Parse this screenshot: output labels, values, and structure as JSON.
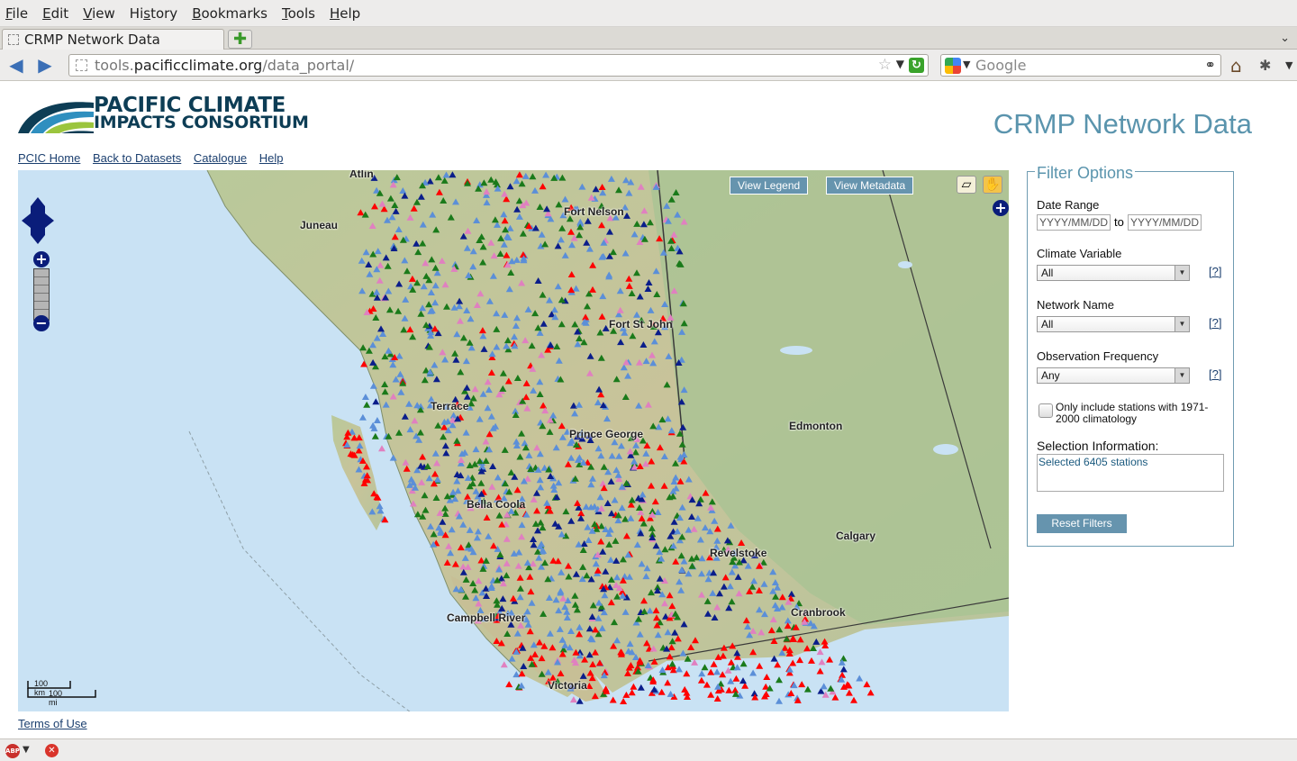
{
  "browser": {
    "menu": [
      {
        "label": "File",
        "key": "F",
        "rest": "ile"
      },
      {
        "label": "Edit",
        "key": "E",
        "rest": "dit"
      },
      {
        "label": "View",
        "key": "V",
        "rest": "iew"
      },
      {
        "label": "History",
        "pre": "Hi",
        "key": "s",
        "rest": "tory"
      },
      {
        "label": "Bookmarks",
        "key": "B",
        "rest": "ookmarks"
      },
      {
        "label": "Tools",
        "key": "T",
        "rest": "ools"
      },
      {
        "label": "Help",
        "key": "H",
        "rest": "elp"
      }
    ],
    "tab_title": "CRMP Network Data",
    "url_prefix": "tools.",
    "url_host": "pacificclimate.org",
    "url_path": "/data_portal/",
    "search_placeholder": "Google"
  },
  "header": {
    "logo_line1": "PACIFIC CLIMATE",
    "logo_line2": "IMPACTS CONSORTIUM",
    "title": "CRMP Network Data"
  },
  "nav_links": [
    "PCIC Home",
    "Back to Datasets",
    "Catalogue",
    "Help"
  ],
  "map": {
    "view_legend": "View Legend",
    "view_metadata": "View Metadata",
    "scale_km": "100 km",
    "scale_mi": "100 mi",
    "cities": [
      {
        "name": "Atlin"
      },
      {
        "name": "Juneau"
      },
      {
        "name": "Fort Nelson"
      },
      {
        "name": "Fort St John"
      },
      {
        "name": "Terrace"
      },
      {
        "name": "Prince George"
      },
      {
        "name": "Edmonton"
      },
      {
        "name": "Bella Coola"
      },
      {
        "name": "Revelstoke"
      },
      {
        "name": "Calgary"
      },
      {
        "name": "Campbell River"
      },
      {
        "name": "Cranbrook"
      },
      {
        "name": "Victoria"
      }
    ],
    "marker_colors": {
      "blue_network": "#5b8fd8",
      "red_network": "#ff0000",
      "green_network": "#1a7a1a",
      "navy_network": "#0a1d8a",
      "pink_network": "#e080c0"
    }
  },
  "terms": "Terms of Use",
  "filters": {
    "legend": "Filter Options",
    "date_range_label": "Date Range",
    "date_from_placeholder": "YYYY/MM/DD",
    "date_to_placeholder": "YYYY/MM/DD",
    "to_label": "to",
    "climate_variable_label": "Climate Variable",
    "climate_variable_value": "All",
    "network_name_label": "Network Name",
    "network_name_value": "All",
    "frequency_label": "Observation Frequency",
    "frequency_value": "Any",
    "help_label": "[?]",
    "climatology_label": "Only include stations with 1971-2000 climatology",
    "selection_label": "Selection Information:",
    "selection_text": "Selected 6405 stations",
    "reset_label": "Reset Filters"
  },
  "colors": {
    "accent": "#6694ae",
    "title": "#5a94ad",
    "link": "#1b3f6f",
    "ocean": "#c9e2f4"
  }
}
